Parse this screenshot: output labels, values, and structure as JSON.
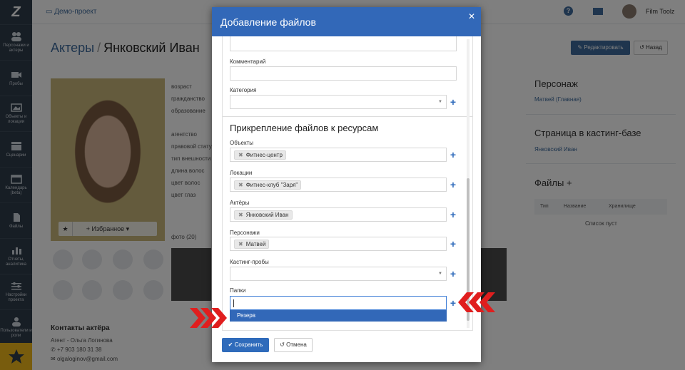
{
  "topbar": {
    "project": "Демо-проект",
    "user": "Film Toolz"
  },
  "sidebar": {
    "items": [
      {
        "label": "Персонажи и актеры",
        "icon": "people-icon"
      },
      {
        "label": "Пробы",
        "icon": "camera-icon"
      },
      {
        "label": "Объекты и локации",
        "icon": "location-icon"
      },
      {
        "label": "Сценарии",
        "icon": "clapper-icon"
      },
      {
        "label": "Календарь (beta)",
        "icon": "calendar-icon"
      },
      {
        "label": "Файлы",
        "icon": "file-icon"
      },
      {
        "label": "Отчеты, аналитика",
        "icon": "chart-icon"
      },
      {
        "label": "Настройки проекта",
        "icon": "settings-icon"
      },
      {
        "label": "Пользователи и роли",
        "icon": "users-icon"
      }
    ]
  },
  "page": {
    "crumb": "Актеры",
    "name": "Янковский Иван",
    "edit_label": "Редактировать",
    "back_label": "Назад",
    "favorite_label": "Избранное",
    "fields": [
      "возраст",
      "гражданство",
      "образование",
      "агентство",
      "правовой стату",
      "тип внешности",
      "длина волос",
      "цвет волос",
      "цвет глаз"
    ],
    "photos_label": "фото (20)",
    "contacts_title": "Контакты актёра",
    "contacts": [
      "Агент - Ольга Логинова",
      "+7 903 180 31 38",
      "olgaloginov@gmail.com"
    ],
    "right": {
      "character_title": "Персонаж",
      "character_value": "Матвей (Главная)",
      "casting_title": "Страница в кастинг-базе",
      "casting_value": "Янковский Иван",
      "files_title": "Файлы",
      "table_cols": [
        "Тип",
        "Название",
        "Хранилище"
      ],
      "empty": "Список пуст"
    }
  },
  "modal": {
    "title": "Добавление файлов",
    "comment_label": "Комментарий",
    "comment_value": "",
    "category_label": "Категория",
    "category_value": "",
    "section_title": "Прикрепление файлов к ресурсам",
    "objects_label": "Объекты",
    "objects_tag": "Фитнес-центр",
    "locations_label": "Локации",
    "locations_tag": "Фитнес-клуб \"Заря\"",
    "actors_label": "Актёры",
    "actors_tag": "Янковский Иван",
    "characters_label": "Персонажи",
    "characters_tag": "Матвей",
    "probes_label": "Кастинг-пробы",
    "probes_value": "",
    "folders_label": "Папки",
    "folders_value": "",
    "folders_option": "Резерв",
    "save_label": "Сохранить",
    "cancel_label": "Отмена"
  },
  "colors": {
    "header": "#3268b8",
    "accent": "#2f6bbb",
    "arrow": "#e01e1e"
  }
}
